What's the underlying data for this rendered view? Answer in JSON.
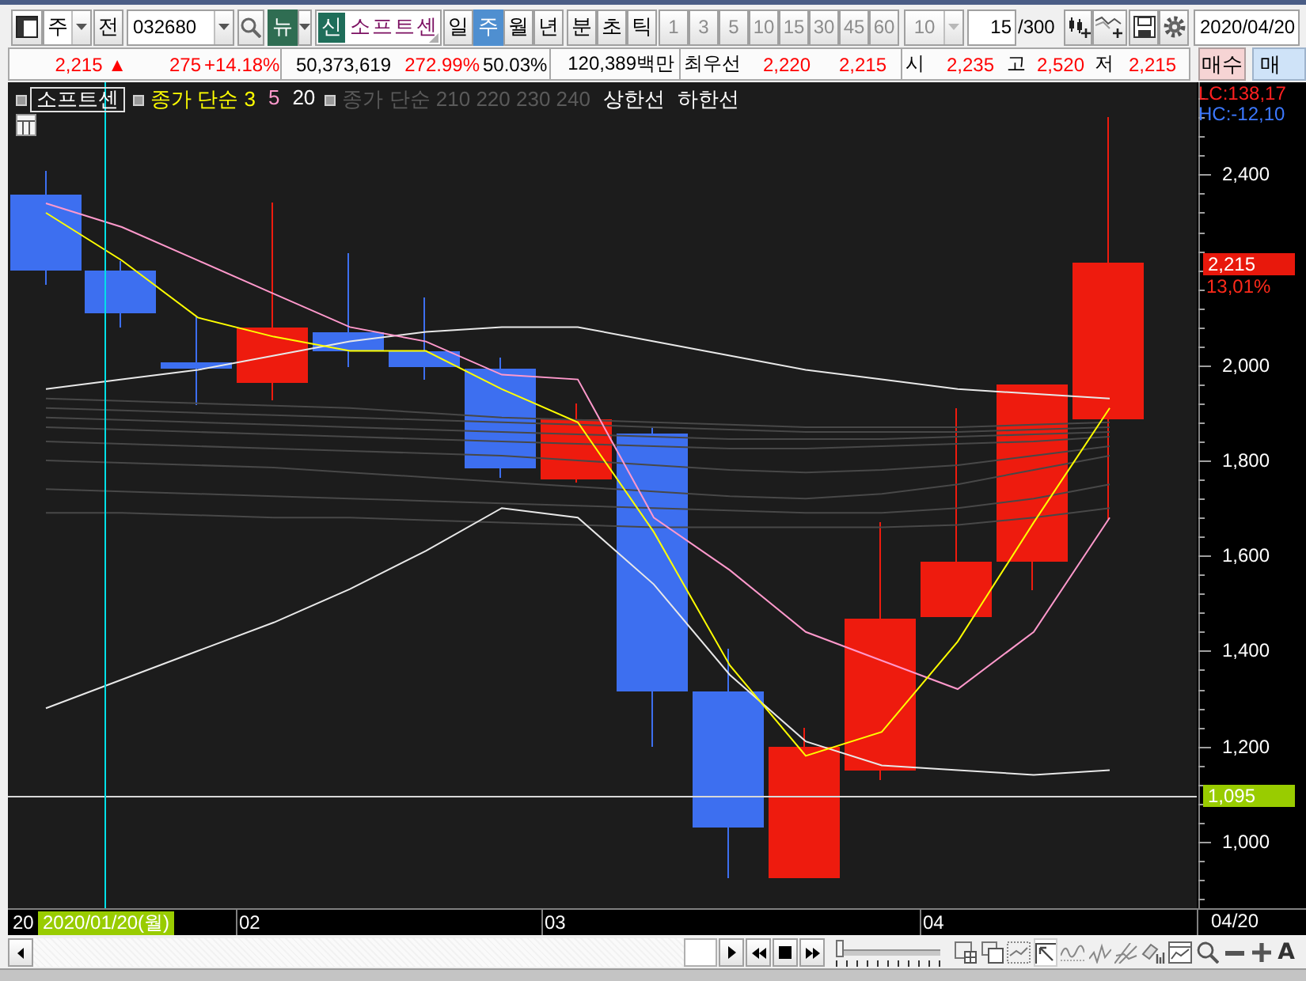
{
  "toolbar": {
    "period_dropdown": {
      "value": "주"
    },
    "prev_button": {
      "label": "전"
    },
    "code_field": {
      "value": "032680"
    },
    "news_button": {
      "label": "뉴"
    },
    "name_field": {
      "badge": "신",
      "value": "소프트센"
    },
    "period_tabs": [
      {
        "label": "일",
        "selected": false
      },
      {
        "label": "주",
        "selected": true
      },
      {
        "label": "월",
        "selected": false
      },
      {
        "label": "년",
        "selected": false
      }
    ],
    "interval_tabs": [
      {
        "label": "분",
        "selected": false
      },
      {
        "label": "초",
        "selected": false
      },
      {
        "label": "틱",
        "selected": false
      }
    ],
    "minute_buttons": [
      {
        "label": "1",
        "disabled": true
      },
      {
        "label": "3",
        "disabled": true
      },
      {
        "label": "5",
        "disabled": true
      },
      {
        "label": "10",
        "disabled": true
      },
      {
        "label": "15",
        "disabled": true
      },
      {
        "label": "30",
        "disabled": true
      },
      {
        "label": "45",
        "disabled": true
      },
      {
        "label": "60",
        "disabled": true
      }
    ],
    "custom_interval": {
      "value": "10",
      "disabled": true
    },
    "count_field": {
      "value": "15",
      "total": "/300"
    },
    "date_field": {
      "value": "2020/04/20"
    }
  },
  "quote_bar": {
    "groups": [
      {
        "items": [
          {
            "text": "2,215 ▲",
            "kind": "value",
            "color": "#ff0000"
          },
          {
            "text": "275",
            "kind": "value",
            "color": "#ff0000"
          },
          {
            "text": "+14.18%",
            "kind": "value",
            "color": "#ff0000"
          }
        ]
      },
      {
        "items": [
          {
            "text": "50,373,619",
            "kind": "value",
            "color": "#000000"
          },
          {
            "text": "272.99%",
            "kind": "value",
            "color": "#ff0000"
          },
          {
            "text": "50.03%",
            "kind": "value",
            "color": "#000000"
          }
        ]
      },
      {
        "items": [
          {
            "text": "120,389백만",
            "kind": "value",
            "color": "#000000"
          }
        ]
      },
      {
        "items": [
          {
            "text": "최우선",
            "kind": "label",
            "color": "#000000"
          },
          {
            "text": "2,220",
            "kind": "value",
            "color": "#ff0000"
          },
          {
            "text": "2,215",
            "kind": "value",
            "color": "#ff0000"
          }
        ]
      },
      {
        "items": [
          {
            "text": "시",
            "kind": "label",
            "color": "#000000"
          },
          {
            "text": "2,235",
            "kind": "value",
            "color": "#ff0000"
          },
          {
            "text": "고",
            "kind": "label",
            "color": "#000000"
          },
          {
            "text": "2,520",
            "kind": "value",
            "color": "#ff0000"
          },
          {
            "text": "저",
            "kind": "label",
            "color": "#000000"
          },
          {
            "text": "2,215",
            "kind": "value",
            "color": "#ff0000"
          }
        ]
      }
    ],
    "buttons": [
      {
        "label": "매수",
        "kind": "buy"
      },
      {
        "label": "매",
        "kind": "sell"
      }
    ]
  },
  "chart": {
    "legend": {
      "title": "소프트센",
      "groups": [
        {
          "items": [
            {
              "text": "종가 단순 3",
              "color": "#ffff00"
            },
            {
              "text": "5",
              "color": "#ff99cc"
            },
            {
              "text": "20",
              "color": "#ffffff"
            }
          ]
        },
        {
          "items": [
            {
              "text": "종가 단순 210 220 230 240",
              "color": "#5a5a5a"
            },
            {
              "text": "상한선",
              "color": "#ffffff"
            },
            {
              "text": "하한선",
              "color": "#ffffff"
            }
          ]
        }
      ]
    },
    "axis_header": [
      {
        "text": "LC:138,17",
        "color": "#ff2020"
      },
      {
        "text": "HC:-12,10",
        "color": "#3c78ff"
      }
    ],
    "chart_data": {
      "type": "line",
      "ylim": [
        860,
        2594
      ],
      "yticks": [
        {
          "value": 2400,
          "label": "2,400"
        },
        {
          "value": 2000,
          "label": "2,000"
        },
        {
          "value": 1800,
          "label": "1,800"
        },
        {
          "value": 1600,
          "label": "1,600"
        },
        {
          "value": 1400,
          "label": "1,400"
        },
        {
          "value": 1200,
          "label": "1,200"
        },
        {
          "value": 1000,
          "label": "1,000"
        }
      ],
      "ref_lines": [
        {
          "axis": "y",
          "value": 1095,
          "label": "1,095"
        }
      ],
      "series": [
        {
          "color": "#484848",
          "values": [
            1930,
            1925,
            1920,
            1915,
            1910,
            1900,
            1890,
            1885,
            1880,
            1875,
            1870,
            1870,
            1870,
            1875,
            1880
          ]
        },
        {
          "color": "#484848",
          "values": [
            1910,
            1905,
            1900,
            1895,
            1890,
            1885,
            1880,
            1875,
            1870,
            1865,
            1860,
            1860,
            1860,
            1865,
            1870
          ]
        },
        {
          "color": "#484848",
          "values": [
            1890,
            1885,
            1880,
            1875,
            1870,
            1865,
            1860,
            1855,
            1850,
            1845,
            1845,
            1845,
            1850,
            1855,
            1860
          ]
        },
        {
          "color": "#484848",
          "values": [
            1870,
            1865,
            1860,
            1855,
            1850,
            1845,
            1840,
            1835,
            1830,
            1825,
            1825,
            1830,
            1835,
            1840,
            1850
          ]
        },
        {
          "color": "#484848",
          "values": [
            1840,
            1835,
            1830,
            1825,
            1820,
            1815,
            1810,
            1800,
            1790,
            1780,
            1775,
            1780,
            1790,
            1810,
            1830
          ]
        },
        {
          "color": "#484848",
          "values": [
            1800,
            1795,
            1790,
            1785,
            1775,
            1765,
            1755,
            1745,
            1735,
            1725,
            1720,
            1730,
            1750,
            1780,
            1810
          ]
        },
        {
          "color": "#484848",
          "values": [
            1740,
            1735,
            1730,
            1725,
            1720,
            1715,
            1710,
            1705,
            1700,
            1695,
            1690,
            1690,
            1700,
            1720,
            1750
          ]
        },
        {
          "color": "#484848",
          "values": [
            1690,
            1690,
            1685,
            1680,
            1680,
            1675,
            1670,
            1665,
            1660,
            1660,
            1660,
            1660,
            1665,
            1680,
            1700
          ]
        },
        {
          "color": "#e8e8e8",
          "values": [
            1950,
            1970,
            1990,
            2020,
            2050,
            2070,
            2080,
            2080,
            2050,
            2020,
            1990,
            1970,
            1950,
            1940,
            1930
          ]
        },
        {
          "color": "#e8e8e8",
          "values": [
            1280,
            1340,
            1400,
            1460,
            1530,
            1610,
            1700,
            1680,
            1540,
            1350,
            1210,
            1160,
            1150,
            1140,
            1150
          ]
        },
        {
          "color": "#ff99cc",
          "values": [
            2340,
            2290,
            2220,
            2150,
            2080,
            2050,
            1980,
            1970,
            1680,
            1570,
            1440,
            1380,
            1320,
            1440,
            1680
          ]
        },
        {
          "color": "#ffff00",
          "values": [
            2320,
            2220,
            2100,
            2060,
            2030,
            2030,
            1950,
            1880,
            1650,
            1370,
            1180,
            1230,
            1420,
            1670,
            1910
          ]
        }
      ]
    },
    "current_price": {
      "value": "2,215",
      "change_rate": "13,01%"
    },
    "time_labels": [
      {
        "text": "20",
        "selected": false
      },
      {
        "text": "2020/01/20(월)",
        "selected": true
      },
      {
        "text": "02",
        "selected": false
      },
      {
        "text": "03",
        "selected": false
      },
      {
        "text": "04",
        "selected": false
      }
    ],
    "last_date": "04/20"
  },
  "playback": {
    "slider": {
      "level": 0.03
    }
  },
  "font_button": "A"
}
